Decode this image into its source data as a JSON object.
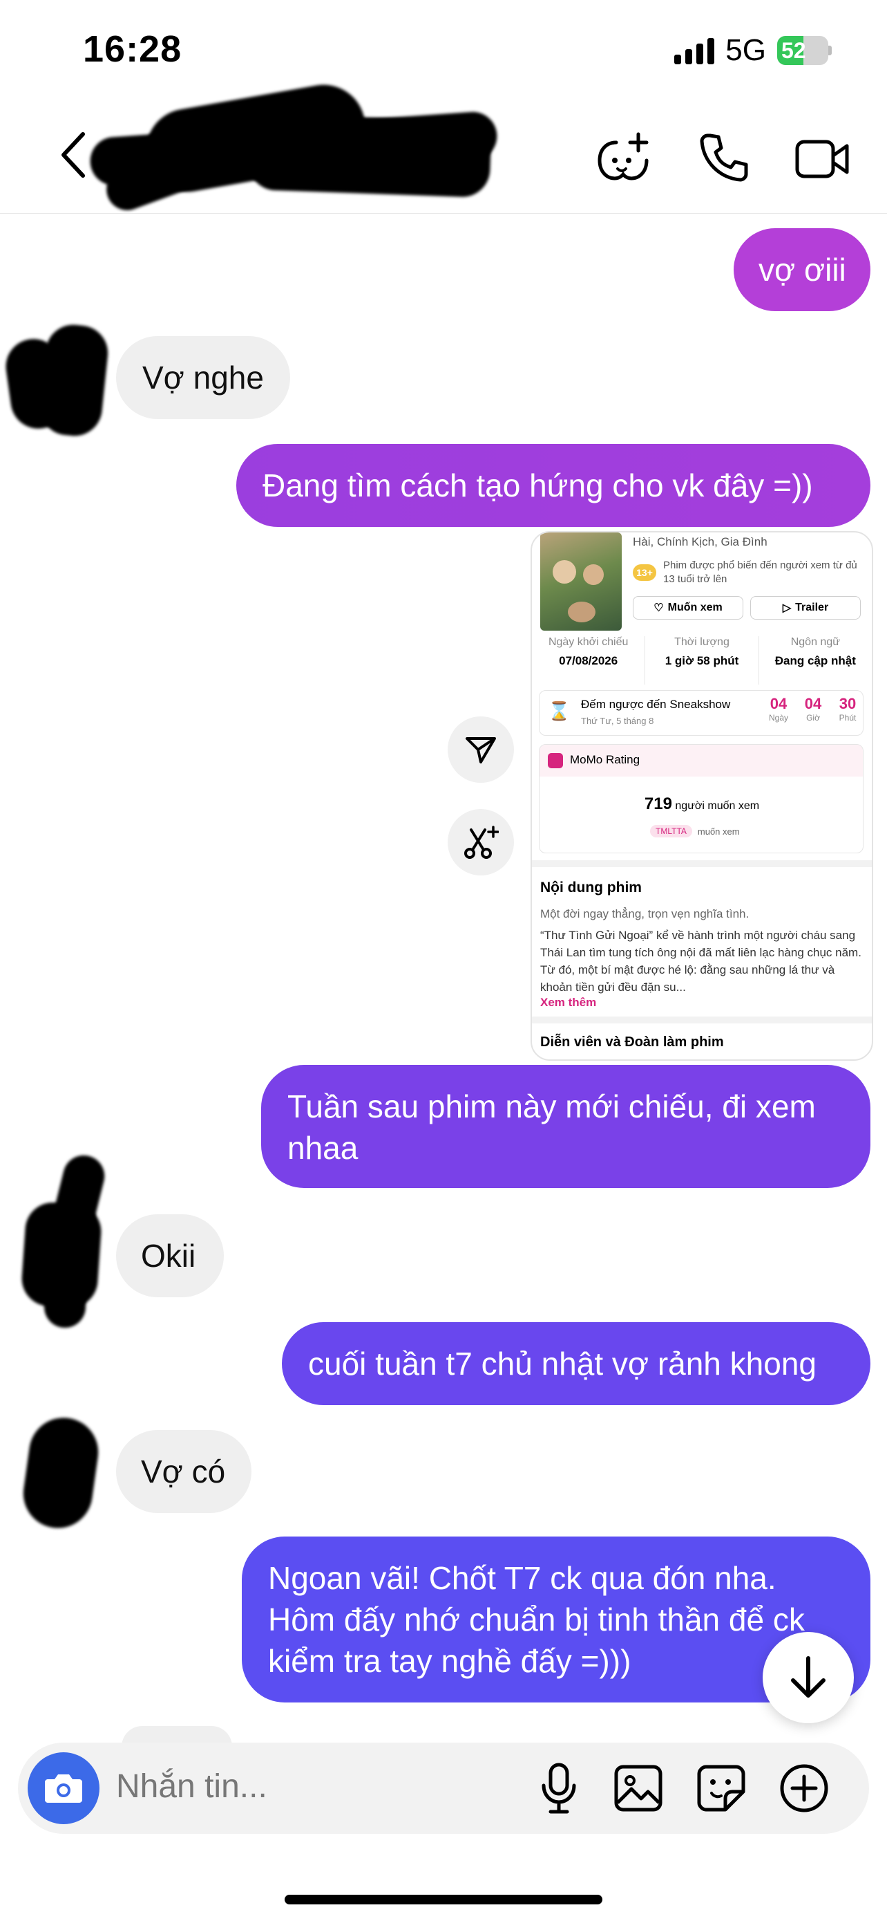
{
  "status_bar": {
    "time": "16:28",
    "network": "5G",
    "battery": "52",
    "battery_level": 0.52
  },
  "header": {
    "back_icon": "chevron-left-icon",
    "actions": [
      "game-controller-add-icon",
      "phone-icon",
      "video-camera-icon"
    ]
  },
  "messages": [
    {
      "dir": "out",
      "text": "vợ ơiii"
    },
    {
      "dir": "in",
      "text": "Vợ nghe"
    },
    {
      "dir": "out",
      "text": "Đang tìm cách tạo hứng cho vk đây =))"
    },
    {
      "dir": "out",
      "text": "Tuần sau phim này mới chiếu, đi xem nhaa"
    },
    {
      "dir": "in",
      "text": "Okii"
    },
    {
      "dir": "out",
      "text": "cuối tuần t7 chủ nhật vợ rảnh khong"
    },
    {
      "dir": "in",
      "text": "Vợ có"
    },
    {
      "dir": "out",
      "text": "Ngoan vãi! Chốt  T7 ck qua đón nha. Hôm đấy nhớ chuẩn bị tinh thần để ck kiểm tra tay nghề đấy =)))"
    }
  ],
  "shared_card": {
    "genres": "Hài, Chính Kịch, Gia Đình",
    "age_badge": "13+",
    "age_note": "Phim được phổ biến đến người xem từ đủ 13 tuổi trở lên",
    "want_button": "Muốn xem",
    "trailer_button": "Trailer",
    "info": [
      {
        "label": "Ngày khởi chiếu",
        "value": "07/08/2026"
      },
      {
        "label": "Thời lượng",
        "value": "1 giờ 58 phút"
      },
      {
        "label": "Ngôn ngữ",
        "value": "Đang cập nhật"
      }
    ],
    "countdown": {
      "title": "Đếm ngược đến Sneakshow",
      "subtitle": "Thứ Tư, 5 tháng 8",
      "units": [
        {
          "value": "04",
          "label": "Ngày"
        },
        {
          "value": "04",
          "label": "Giờ"
        },
        {
          "value": "30",
          "label": "Phút"
        }
      ]
    },
    "rating": {
      "title": "MoMo Rating",
      "count": "719",
      "count_label": "người muốn xem",
      "tag": "TMLTTA",
      "tag_label": "muốn xem"
    },
    "content_title": "Nội dung phim",
    "tagline": "Một đời ngay thẳng, trọn vẹn nghĩa tình.",
    "description": "“Thư Tình Gửi Ngoại” kể về hành trình một người cháu sang Thái Lan tìm tung tích ông nội đã mất liên lạc hàng chục năm. Từ đó, một bí mật được hé lộ: đằng sau những lá thư và khoản tiền gửi đều đặn su...",
    "read_more": "Xem thêm",
    "cast_title": "Diễn viên và Đoàn làm phim"
  },
  "reaction_buttons": [
    "send-icon",
    "scissors-sparkle-icon"
  ],
  "composer": {
    "placeholder": "Nhắn tin...",
    "icons": [
      "camera-icon",
      "microphone-icon",
      "image-icon",
      "sticker-icon",
      "plus-circle-icon"
    ]
  },
  "colors": {
    "bubble_out_top": "#b43fd8",
    "bubble_out_mid": "#7b40e8",
    "bubble_out_bottom": "#5b4ef2",
    "bubble_in": "#efefef",
    "camera_button": "#3c6ae8",
    "accent_pink": "#d6247e"
  }
}
